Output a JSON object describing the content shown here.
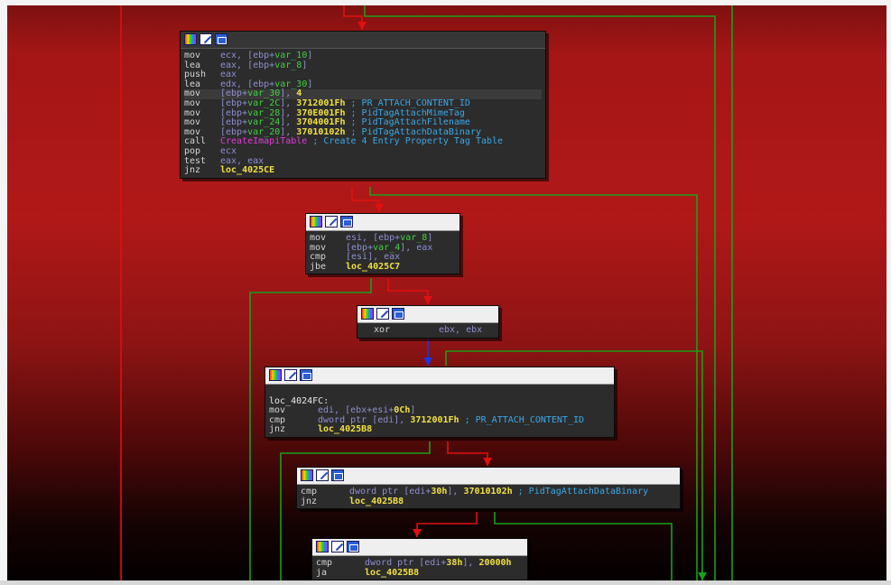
{
  "accent_colors": {
    "false_edge": "#e01010",
    "true_edge": "#18a018",
    "unconditional_edge": "#1c35e6",
    "text_mnemonic": "#d4d4d4",
    "text_operand": "#8e8ed2",
    "text_variable": "#3ed23e",
    "text_number": "#f0e040",
    "text_function": "#e23bd9",
    "text_comment": "#3aa8e8"
  },
  "header_icons": [
    "color-palette-icon",
    "edit-node-icon",
    "graph-node-icon"
  ],
  "nodes": [
    {
      "id": "node_4025a0",
      "lines": [
        {
          "mn": "mov",
          "ops": [
            {
              "t": "ecx, [ebp+",
              "c": "op"
            },
            {
              "t": "var_10",
              "c": "vr"
            },
            {
              "t": "]",
              "c": "op"
            }
          ]
        },
        {
          "mn": "lea",
          "ops": [
            {
              "t": "eax, [ebp+",
              "c": "op"
            },
            {
              "t": "var_8",
              "c": "vr"
            },
            {
              "t": "]",
              "c": "op"
            }
          ]
        },
        {
          "mn": "push",
          "ops": [
            {
              "t": "eax",
              "c": "op"
            }
          ]
        },
        {
          "mn": "lea",
          "ops": [
            {
              "t": "edx, [ebp+",
              "c": "op"
            },
            {
              "t": "var_30",
              "c": "vr"
            },
            {
              "t": "]",
              "c": "op"
            }
          ]
        },
        {
          "mn": "mov",
          "hl": true,
          "ops": [
            {
              "t": "[ebp+",
              "c": "op"
            },
            {
              "t": "var_30",
              "c": "vr"
            },
            {
              "t": "], ",
              "c": "op"
            },
            {
              "t": "4",
              "c": "nm"
            }
          ]
        },
        {
          "mn": "mov",
          "ops": [
            {
              "t": "[ebp+",
              "c": "op"
            },
            {
              "t": "var_2C",
              "c": "vr"
            },
            {
              "t": "], ",
              "c": "op"
            },
            {
              "t": "3712001Fh",
              "c": "nm"
            },
            {
              "t": " ; PR_ATTACH_CONTENT_ID",
              "c": "cm"
            }
          ]
        },
        {
          "mn": "mov",
          "ops": [
            {
              "t": "[ebp+",
              "c": "op"
            },
            {
              "t": "var_28",
              "c": "vr"
            },
            {
              "t": "], ",
              "c": "op"
            },
            {
              "t": "370E001Fh",
              "c": "nm"
            },
            {
              "t": " ; PidTagAttachMimeTag",
              "c": "cm"
            }
          ]
        },
        {
          "mn": "mov",
          "ops": [
            {
              "t": "[ebp+",
              "c": "op"
            },
            {
              "t": "var_24",
              "c": "vr"
            },
            {
              "t": "], ",
              "c": "op"
            },
            {
              "t": "3704001Fh",
              "c": "nm"
            },
            {
              "t": " ; PidTagAttachFilename",
              "c": "cm"
            }
          ]
        },
        {
          "mn": "mov",
          "ops": [
            {
              "t": "[ebp+",
              "c": "op"
            },
            {
              "t": "var_20",
              "c": "vr"
            },
            {
              "t": "], ",
              "c": "op"
            },
            {
              "t": "37010102h",
              "c": "nm"
            },
            {
              "t": " ; PidTagAttachDataBinary",
              "c": "cm"
            }
          ]
        },
        {
          "mn": "call",
          "ops": [
            {
              "t": "CreateImapiTable",
              "c": "fn"
            },
            {
              "t": " ; Create 4 Entry Property Tag Table",
              "c": "cm"
            }
          ]
        },
        {
          "mn": "pop",
          "ops": [
            {
              "t": "ecx",
              "c": "op"
            }
          ]
        },
        {
          "mn": "test",
          "ops": [
            {
              "t": "eax, eax",
              "c": "op"
            }
          ]
        },
        {
          "mn": "jnz",
          "ops": [
            {
              "t": "loc_4025CE",
              "c": "jt"
            }
          ]
        }
      ]
    },
    {
      "id": "node_4025e4",
      "lines": [
        {
          "mn": "mov",
          "ops": [
            {
              "t": "esi, [ebp+",
              "c": "op"
            },
            {
              "t": "var_8",
              "c": "vr"
            },
            {
              "t": "]",
              "c": "op"
            }
          ]
        },
        {
          "mn": "mov",
          "ops": [
            {
              "t": "[ebp+",
              "c": "op"
            },
            {
              "t": "var_4",
              "c": "vr"
            },
            {
              "t": "], eax",
              "c": "op"
            }
          ]
        },
        {
          "mn": "cmp",
          "ops": [
            {
              "t": "[esi], eax",
              "c": "op"
            }
          ]
        },
        {
          "mn": "jbe",
          "ops": [
            {
              "t": "loc_4025C7",
              "c": "jt"
            }
          ]
        }
      ]
    },
    {
      "id": "node_4024fa",
      "lines": [
        {
          "mn": "xor",
          "ops": [
            {
              "t": "ebx, ebx",
              "c": "op"
            }
          ]
        }
      ]
    },
    {
      "id": "node_4024fc",
      "lines": [
        {
          "label": ""
        },
        {
          "label": "loc_4024FC:"
        },
        {
          "mn": "mov",
          "ops": [
            {
              "t": "edi, [ebx+esi+",
              "c": "op"
            },
            {
              "t": "0Ch",
              "c": "nm"
            },
            {
              "t": "]",
              "c": "op"
            }
          ]
        },
        {
          "mn": "cmp",
          "ops": [
            {
              "t": "dword ptr [edi], ",
              "c": "op"
            },
            {
              "t": "3712001Fh",
              "c": "nm"
            },
            {
              "t": " ; PR_ATTACH_CONTENT_ID",
              "c": "cm"
            }
          ]
        },
        {
          "mn": "jnz",
          "ops": [
            {
              "t": "loc_4025B8",
              "c": "jt"
            }
          ]
        }
      ]
    },
    {
      "id": "node_402508",
      "lines": [
        {
          "mn": "cmp",
          "ops": [
            {
              "t": "dword ptr [edi+",
              "c": "op"
            },
            {
              "t": "30h",
              "c": "nm"
            },
            {
              "t": "], ",
              "c": "op"
            },
            {
              "t": "37010102h",
              "c": "nm"
            },
            {
              "t": " ; PidTagAttachDataBinary",
              "c": "cm"
            }
          ]
        },
        {
          "mn": "jnz",
          "ops": [
            {
              "t": "loc_4025B8",
              "c": "jt"
            }
          ]
        }
      ]
    },
    {
      "id": "node_402511",
      "lines": [
        {
          "mn": "cmp",
          "ops": [
            {
              "t": "dword ptr [edi+",
              "c": "op"
            },
            {
              "t": "38h",
              "c": "nm"
            },
            {
              "t": "], ",
              "c": "op"
            },
            {
              "t": "20000h",
              "c": "nm"
            }
          ]
        },
        {
          "mn": "ja",
          "ops": [
            {
              "t": "loc_4025B8",
              "c": "jt"
            }
          ]
        }
      ]
    }
  ]
}
